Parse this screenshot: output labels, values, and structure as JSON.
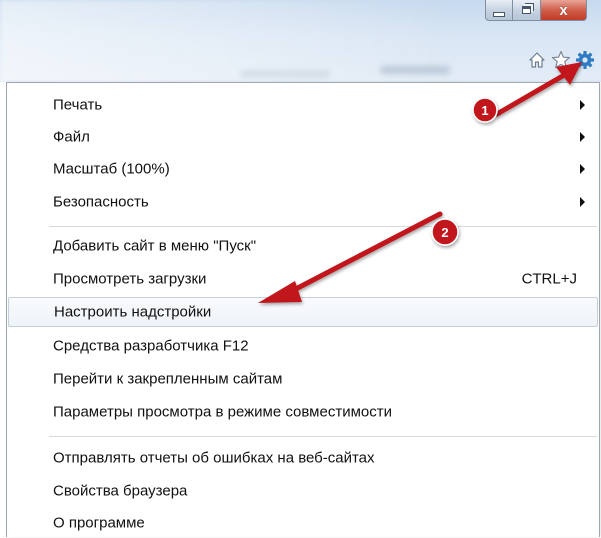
{
  "window": {
    "controls": {
      "minimize_icon": "minimize-icon",
      "maximize_icon": "maximize-icon",
      "close_icon": "close-icon",
      "close_glyph": "x"
    }
  },
  "toolbar": {
    "icons": [
      "home-icon",
      "favorites-star-icon",
      "gear-icon"
    ]
  },
  "menu": {
    "group1": [
      {
        "label": "Печать",
        "submenu": true
      },
      {
        "label": "Файл",
        "submenu": true
      },
      {
        "label": "Масштаб (100%)",
        "submenu": true
      },
      {
        "label": "Безопасность",
        "submenu": true
      }
    ],
    "group2": [
      {
        "label": "Добавить сайт в меню \"Пуск\""
      },
      {
        "label": "Просмотреть загрузки",
        "shortcut": "CTRL+J"
      },
      {
        "label": "Настроить надстройки",
        "highlighted": true
      },
      {
        "label": "Средства разработчика F12"
      },
      {
        "label": "Перейти к закрепленным сайтам"
      },
      {
        "label": "Параметры просмотра в режиме совместимости"
      }
    ],
    "group3": [
      {
        "label": "Отправлять отчеты об ошибках на веб-сайтах"
      },
      {
        "label": "Свойства браузера"
      },
      {
        "label": "О программе"
      }
    ]
  },
  "annotations": {
    "badge1": "1",
    "badge2": "2",
    "color": "#c0161b"
  }
}
